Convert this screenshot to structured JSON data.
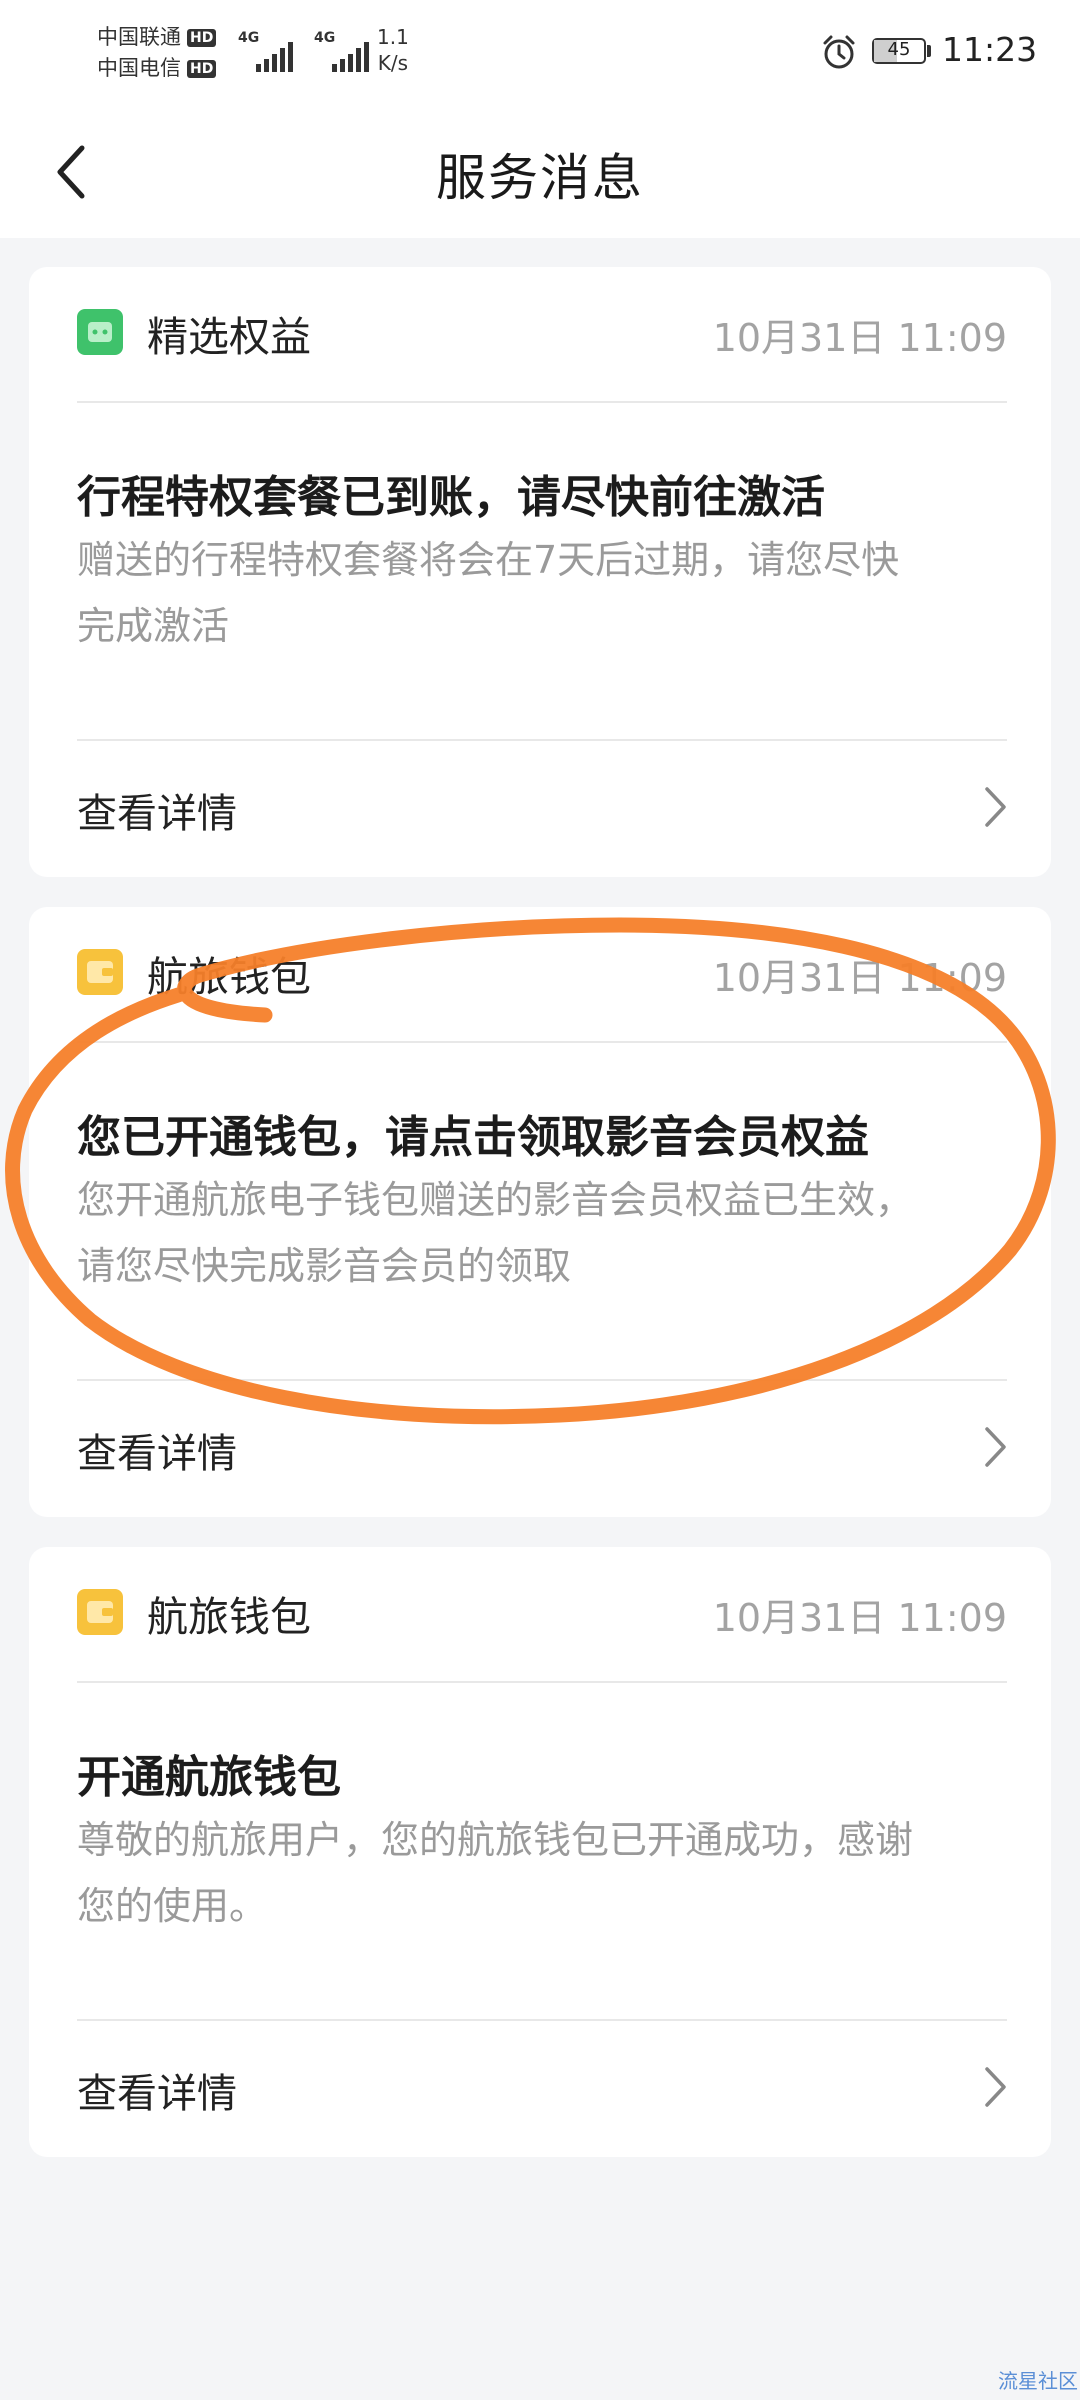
{
  "status_bar": {
    "carriers": [
      {
        "name": "中国联通",
        "badge": "HD"
      },
      {
        "name": "中国电信",
        "badge": "HD"
      }
    ],
    "network_types": [
      "4G",
      "4G"
    ],
    "speed_value": "1.1",
    "speed_unit": "K/s",
    "battery_level": "45",
    "time": "11:23",
    "icons": [
      "alarm-icon",
      "battery-icon",
      "signal-icon"
    ]
  },
  "header": {
    "title": "服务消息",
    "back_icon": "chevron-left-icon"
  },
  "messages": [
    {
      "app_name": "精选权益",
      "app_icon": "green-robot-icon",
      "time": "10月31日 11:09",
      "title": "行程特权套餐已到账，请尽快前往激活",
      "body_lines": [
        "赠送的行程特权套餐将会在7天后过期，请您尽快",
        "完成激活"
      ],
      "detail_label": "查看详情"
    },
    {
      "app_name": "航旅钱包",
      "app_icon": "wallet-icon",
      "time": "10月31日 11:09",
      "title": "您已开通钱包，请点击领取影音会员权益",
      "body_lines": [
        "您开通航旅电子钱包赠送的影音会员权益已生效，",
        "请您尽快完成影音会员的领取"
      ],
      "detail_label": "查看详情"
    },
    {
      "app_name": "航旅钱包",
      "app_icon": "wallet-icon",
      "time": "10月31日 11:09",
      "title": "开通航旅钱包",
      "body_lines": [
        "尊敬的航旅用户，您的航旅钱包已开通成功，感谢",
        "您的使用。"
      ],
      "detail_label": "查看详情"
    }
  ],
  "colors": {
    "page_background": "#f4f5f7",
    "card_background": "#ffffff",
    "annotation_orange": "#f5802a",
    "wallet_icon": "#f7c23c",
    "robot_icon": "#3fc26b"
  },
  "watermark": "流星社区"
}
